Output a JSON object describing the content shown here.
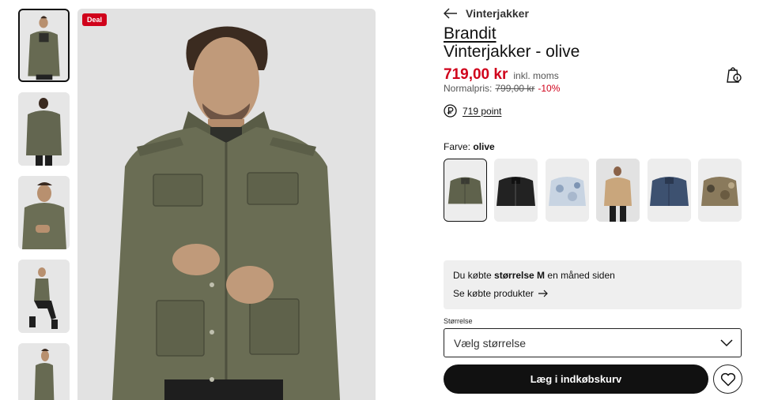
{
  "gallery": {
    "deal_badge": "Deal",
    "thumbnails": [
      {
        "name": "front-view",
        "active": true
      },
      {
        "name": "back-view",
        "active": false
      },
      {
        "name": "detail-view",
        "active": false
      },
      {
        "name": "seated-view",
        "active": false
      },
      {
        "name": "side-view",
        "active": false
      }
    ]
  },
  "product": {
    "breadcrumb": "Vinterjakker",
    "brand": "Brandit",
    "name": "Vinterjakker - olive",
    "price": "719,00 kr",
    "vat_note": "inkl. moms",
    "normal_label": "Normalpris:",
    "normal_price": "799,00 kr",
    "discount": "-10%",
    "points": "719 point"
  },
  "color": {
    "label": "Farve:",
    "selected": "olive",
    "swatches": [
      {
        "name": "olive",
        "color": "#5f624c",
        "active": true
      },
      {
        "name": "black",
        "color": "#222222",
        "active": false
      },
      {
        "name": "light-camo",
        "color": "#c8d4e2",
        "active": false
      },
      {
        "name": "camel",
        "color": "#c9a67c",
        "active": false
      },
      {
        "name": "navy",
        "color": "#3d5170",
        "active": false
      },
      {
        "name": "woodland-camo",
        "color": "#8a7a5c",
        "active": false
      }
    ]
  },
  "purchase_history": {
    "prefix": "Du købte",
    "size_text": "størrelse M",
    "suffix": "en måned siden",
    "link": "Se købte produkter"
  },
  "size": {
    "label": "Størrelse",
    "placeholder": "Vælg størrelse"
  },
  "actions": {
    "add_to_cart": "Læg i indkøbskurv"
  },
  "colors": {
    "sale_red": "#d0021b",
    "button_black": "#111111",
    "panel_grey": "#efefef"
  }
}
